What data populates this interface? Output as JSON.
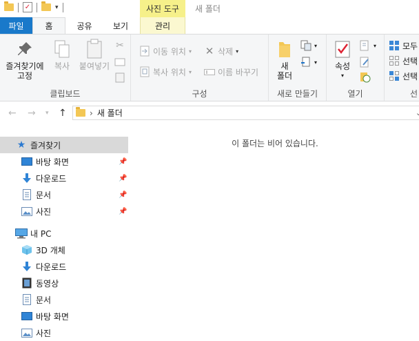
{
  "window": {
    "title": "새 폴더",
    "context_tab_group": "사진 도구"
  },
  "ribbon_tabs": {
    "file": "파일",
    "home": "홈",
    "share": "공유",
    "view": "보기",
    "manage": "관리"
  },
  "clipboard": {
    "group_label": "클립보드",
    "pin_label_1": "즐겨찾기에",
    "pin_label_2": "고정",
    "copy": "복사",
    "paste": "붙여넣기"
  },
  "organize": {
    "group_label": "구성",
    "move_to": "이동 위치",
    "copy_to": "복사 위치",
    "delete": "삭제",
    "rename": "이름 바꾸기"
  },
  "new": {
    "group_label": "새로 만들기",
    "new_folder_1": "새",
    "new_folder_2": "폴더"
  },
  "open": {
    "group_label": "열기",
    "properties": "속성"
  },
  "select": {
    "select_all": "모두",
    "select_none": "선택",
    "invert": "선택",
    "group_label_partial": "선"
  },
  "address": {
    "path_item": "새 폴더"
  },
  "nav_pane": {
    "quick_access": "즐겨찾기",
    "qa_items": [
      "바탕 화면",
      "다운로드",
      "문서",
      "사진"
    ],
    "this_pc": "내 PC",
    "pc_items": [
      "3D 개체",
      "다운로드",
      "동영상",
      "문서",
      "바탕 화면",
      "사진"
    ]
  },
  "content": {
    "empty_message": "이 폴더는 비어 있습니다."
  },
  "colors": {
    "file_tab": "#1979ca",
    "context_tab": "#f6f08a",
    "selection": "#d9d9d9",
    "folder": "#f3c755"
  }
}
